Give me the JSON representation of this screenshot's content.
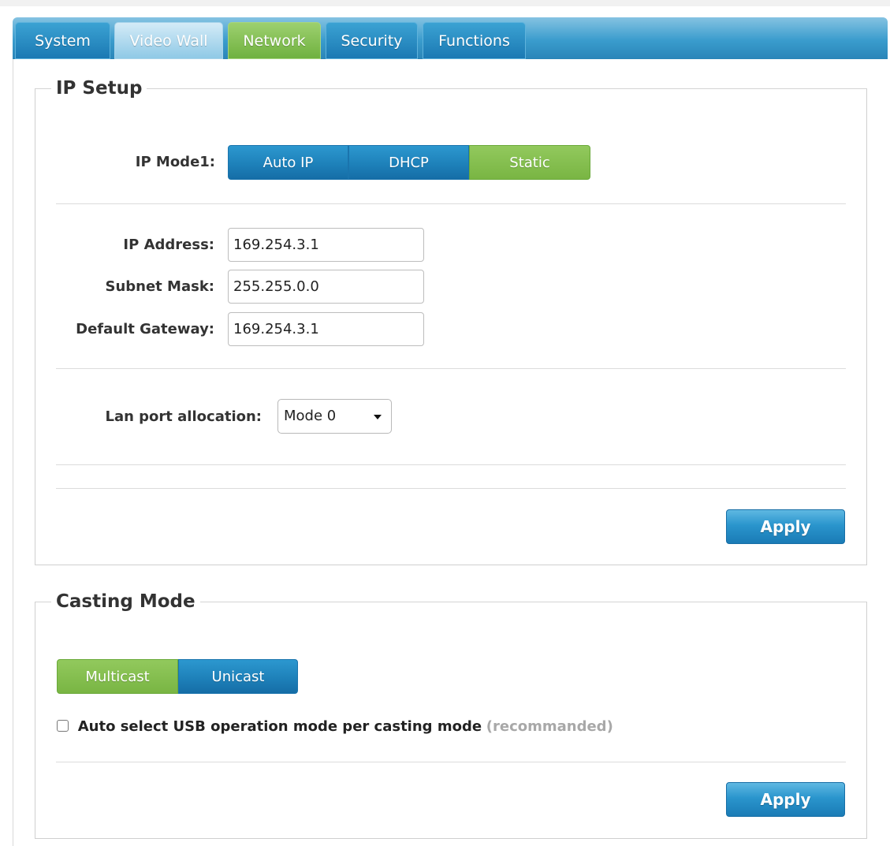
{
  "tabs": [
    {
      "label": "System",
      "state": "normal"
    },
    {
      "label": "Video Wall",
      "state": "light"
    },
    {
      "label": "Network",
      "state": "active"
    },
    {
      "label": "Security",
      "state": "normal"
    },
    {
      "label": "Functions",
      "state": "normal"
    }
  ],
  "ip_setup": {
    "legend": "IP Setup",
    "mode_label": "IP Mode1:",
    "modes": [
      "Auto IP",
      "DHCP",
      "Static"
    ],
    "selected_mode": "Static",
    "ip_address_label": "IP Address:",
    "ip_address_value": "169.254.3.1",
    "subnet_mask_label": "Subnet Mask:",
    "subnet_mask_value": "255.255.0.0",
    "gateway_label": "Default Gateway:",
    "gateway_value": "169.254.3.1",
    "lan_label": "Lan port allocation:",
    "lan_value": "Mode 0",
    "apply_label": "Apply"
  },
  "casting": {
    "legend": "Casting Mode",
    "modes": [
      "Multicast",
      "Unicast"
    ],
    "selected_mode": "Multicast",
    "checkbox_label": "Auto select USB operation mode per casting mode",
    "checkbox_hint": "(recommanded)",
    "checkbox_checked": false,
    "apply_label": "Apply"
  },
  "colors": {
    "tab_blue": "#1b79b3",
    "active_green": "#79b543",
    "button_blue": "#1d7fb8"
  }
}
